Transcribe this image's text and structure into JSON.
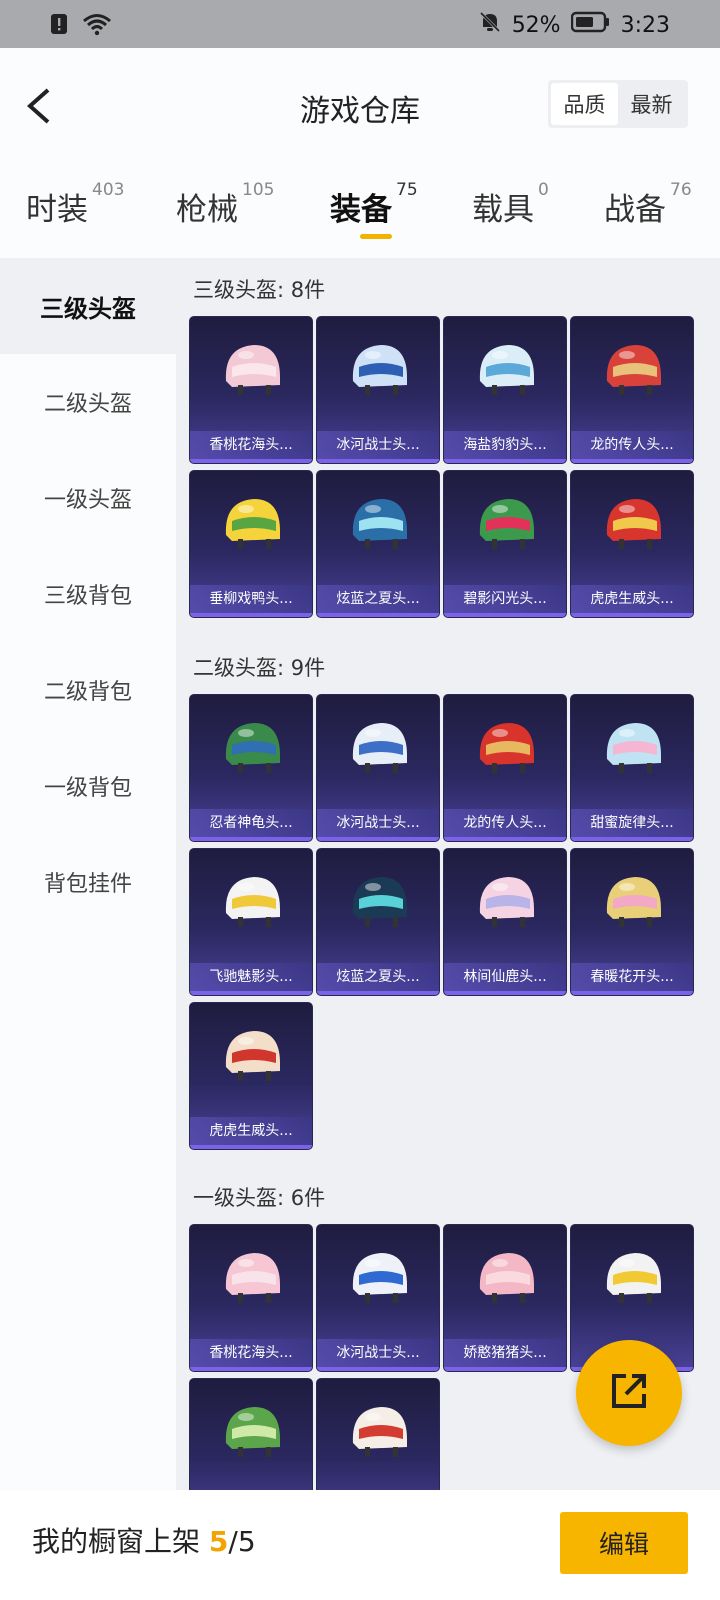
{
  "status": {
    "battery_pct": "52%",
    "time": "3:23"
  },
  "header": {
    "title": "游戏仓库",
    "sort": [
      "品质",
      "最新"
    ]
  },
  "tabs": [
    {
      "label": "时装",
      "count": "403"
    },
    {
      "label": "枪械",
      "count": "105"
    },
    {
      "label": "装备",
      "count": "75"
    },
    {
      "label": "载具",
      "count": "0"
    },
    {
      "label": "战备",
      "count": "76"
    }
  ],
  "sidebar": [
    "三级头盔",
    "二级头盔",
    "一级头盔",
    "三级背包",
    "二级背包",
    "一级背包",
    "背包挂件"
  ],
  "sections": [
    {
      "title": "三级头盔: 8件",
      "items": [
        "香桃花海头...",
        "冰河战士头...",
        "海盐豹豹头...",
        "龙的传人头...",
        "垂柳戏鸭头...",
        "炫蓝之夏头...",
        "碧影闪光头...",
        "虎虎生威头..."
      ]
    },
    {
      "title": "二级头盔: 9件",
      "items": [
        "忍者神龟头...",
        "冰河战士头...",
        "龙的传人头...",
        "甜蜜旋律头...",
        "飞驰魅影头...",
        "炫蓝之夏头...",
        "林间仙鹿头...",
        "春暖花开头...",
        "虎虎生威头..."
      ]
    },
    {
      "title": "一级头盔: 6件",
      "items": [
        "香桃花海头...",
        "冰河战士头...",
        "娇憨猪猪头...",
        "",
        "",
        ""
      ]
    }
  ],
  "footer": {
    "label": "我的橱窗上架",
    "current": "5",
    "total": "/5",
    "edit": "编辑"
  },
  "colors": {
    "accent": "#f7b500",
    "card_bg": "#2b2860"
  }
}
